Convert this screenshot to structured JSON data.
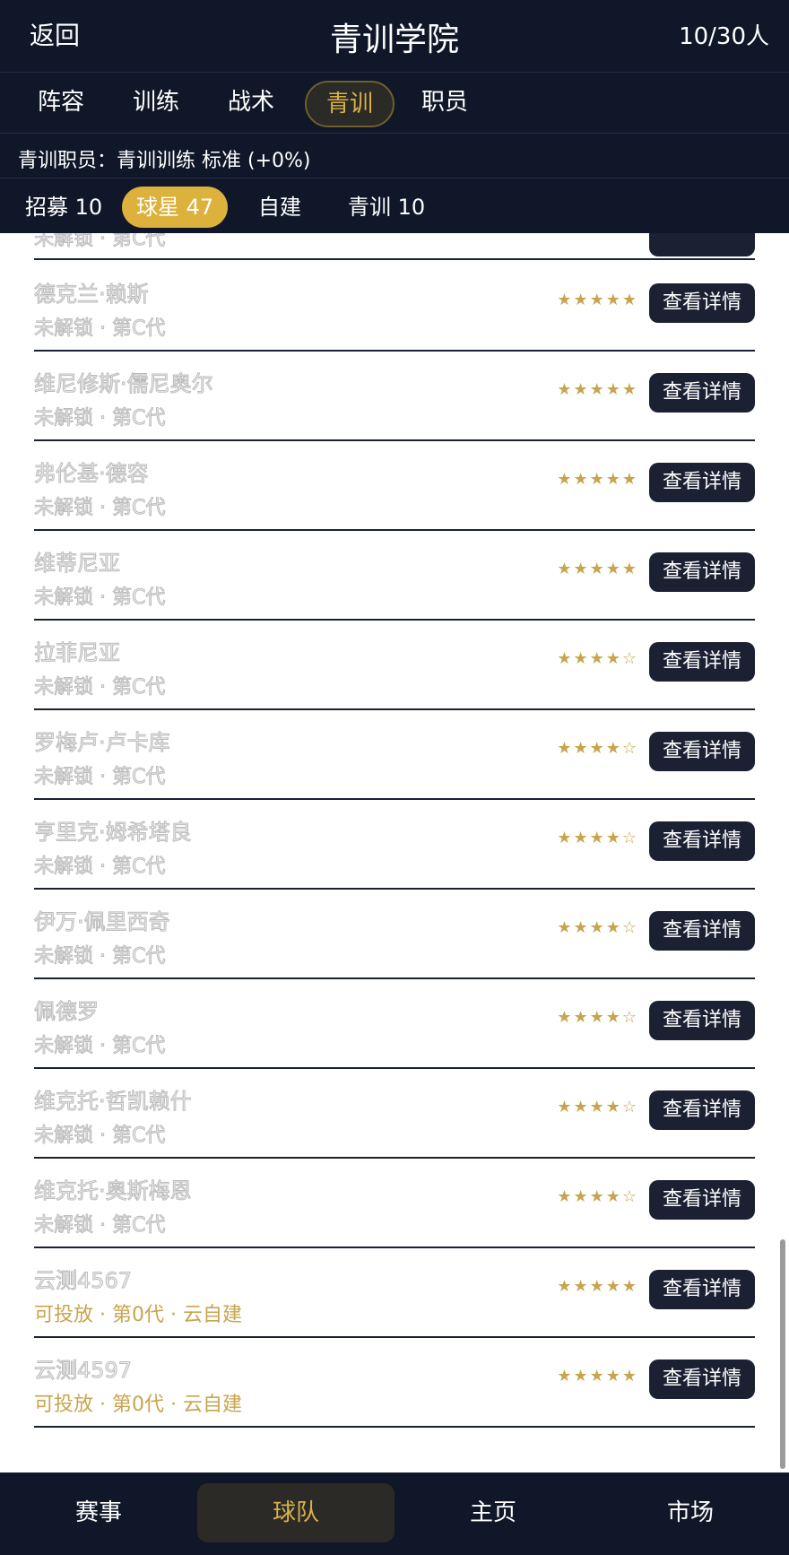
{
  "header": {
    "back_label": "返回",
    "title": "青训学院",
    "count": "10/30人"
  },
  "tabs": [
    "阵容",
    "训练",
    "战术",
    "青训",
    "职员"
  ],
  "active_tab": "青训",
  "staff_line": "青训职员：青训训练 标准 (+0%)",
  "subtabs": [
    "招募 10",
    "球星 47",
    "自建",
    "青训 10"
  ],
  "active_subtab": "球星 47",
  "list_partial_meta": "未解锁 · 第C代",
  "players": [
    {
      "name": "德克兰·赖斯",
      "meta": "未解锁 · 第C代",
      "stars": "★★★★★",
      "button": "查看详情"
    },
    {
      "name": "维尼修斯·儒尼奥尔",
      "meta": "未解锁 · 第C代",
      "stars": "★★★★★",
      "button": "查看详情"
    },
    {
      "name": "弗伦基·德容",
      "meta": "未解锁 · 第C代",
      "stars": "★★★★★",
      "button": "查看详情"
    },
    {
      "name": "维蒂尼亚",
      "meta": "未解锁 · 第C代",
      "stars": "★★★★★",
      "button": "查看详情"
    },
    {
      "name": "拉菲尼亚",
      "meta": "未解锁 · 第C代",
      "stars": "★★★★☆",
      "button": "查看详情"
    },
    {
      "name": "罗梅卢·卢卡库",
      "meta": "未解锁 · 第C代",
      "stars": "★★★★☆",
      "button": "查看详情"
    },
    {
      "name": "亨里克·姆希塔良",
      "meta": "未解锁 · 第C代",
      "stars": "★★★★☆",
      "button": "查看详情"
    },
    {
      "name": "伊万·佩里西奇",
      "meta": "未解锁 · 第C代",
      "stars": "★★★★☆",
      "button": "查看详情"
    },
    {
      "name": "佩德罗",
      "meta": "未解锁 · 第C代",
      "stars": "★★★★☆",
      "button": "查看详情"
    },
    {
      "name": "维克托·哲凯赖什",
      "meta": "未解锁 · 第C代",
      "stars": "★★★★☆",
      "button": "查看详情"
    },
    {
      "name": "维克托·奥斯梅恩",
      "meta": "未解锁 · 第C代",
      "stars": "★★★★☆",
      "button": "查看详情"
    },
    {
      "name": "云测4567",
      "meta": "可投放 · 第0代 · 云自建",
      "stars": "★★★★★",
      "button": "查看详情",
      "meta_gold": true
    },
    {
      "name": "云测4597",
      "meta": "可投放 · 第0代 · 云自建",
      "stars": "★★★★★",
      "button": "查看详情",
      "meta_gold": true
    }
  ],
  "bottom_nav": [
    "赛事",
    "球队",
    "主页",
    "市场"
  ],
  "active_nav": "球队"
}
